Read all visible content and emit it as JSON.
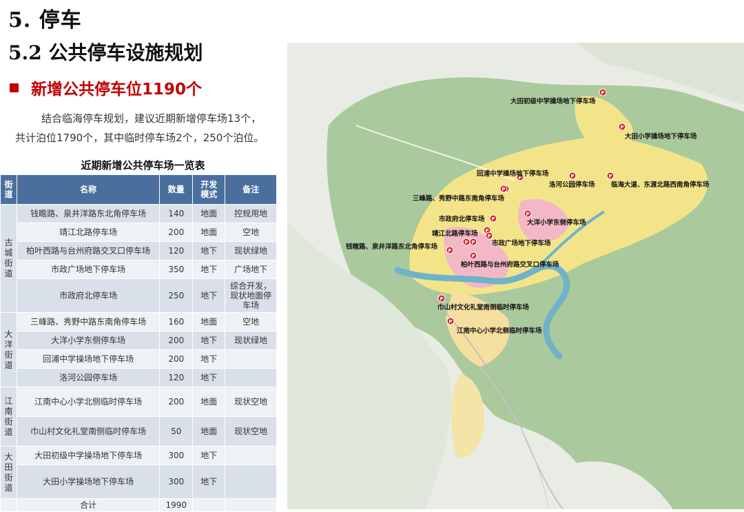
{
  "heading1": "5. 停车",
  "heading2": "5.2 公共停车设施规划",
  "heading3": "新增公共停车位1190个",
  "paragraph_line1": "结合临海停车规划，建议近期新增停车场13个，",
  "paragraph_line2": "共计泊位1790个，其中临时停车场2个，250个泊位。",
  "table_title": "近期新增公共停车场一览表",
  "table_headers": {
    "street": "街道",
    "name": "名称",
    "count": "数量",
    "mode": "开发模式",
    "note": "备注"
  },
  "streets": {
    "gucheng": "古城街道",
    "dayang": "大洋街道",
    "jiangnan": "江南街道",
    "datian": "大田街道"
  },
  "rows": [
    {
      "name": "钱瞻路、泉井洋路东北角停车场",
      "count": "140",
      "mode": "地面",
      "note": "控规用地"
    },
    {
      "name": "靖江北路停车场",
      "count": "200",
      "mode": "地面",
      "note": "空地"
    },
    {
      "name": "柏叶西路与台州府路交叉口停车场",
      "count": "120",
      "mode": "地下",
      "note": "现状绿地"
    },
    {
      "name": "市政广场地下停车场",
      "count": "350",
      "mode": "地下",
      "note": "广场地下"
    },
    {
      "name": "市政府北停车场",
      "count": "250",
      "mode": "地下",
      "note": "综合开发，现状地面停车场"
    },
    {
      "name": "三峰路、秀野中路东南角停车场",
      "count": "160",
      "mode": "地面",
      "note": "空地"
    },
    {
      "name": "大洋小学东侧停车场",
      "count": "200",
      "mode": "地下",
      "note": "现状绿地"
    },
    {
      "name": "回浦中学操场地下停车场",
      "count": "200",
      "mode": "地下",
      "note": ""
    },
    {
      "name": "洛河公园停车场",
      "count": "120",
      "mode": "地下",
      "note": ""
    },
    {
      "name": "江南中心小学北侧临时停车场",
      "count": "200",
      "mode": "地面",
      "note": "现状空地"
    },
    {
      "name": "巾山村文化礼堂南侧临时停车场",
      "count": "50",
      "mode": "地面",
      "note": "现状空地"
    },
    {
      "name": "大田初级中学操场地下停车场",
      "count": "300",
      "mode": "地下",
      "note": ""
    },
    {
      "name": "大田小学操场地下停车场",
      "count": "300",
      "mode": "地下",
      "note": ""
    }
  ],
  "total": {
    "label": "合计",
    "count": "1990"
  },
  "map_icon": "P",
  "map_labels": [
    "大田初级中学操场地下停车场",
    "大田小学操场地下停车场",
    "回浦中学操场地下停车场",
    "洛河公园停车场",
    "临海大道、东渡北路西南角停车场",
    "三峰路、秀野中路东南角停车场",
    "大洋小学东侧停车场",
    "市政府北停车场",
    "靖江北路停车场",
    "市政广场地下停车场",
    "钱暄路、泉井洋路东北角停车场",
    "柏叶西路与台州府路交叉口停车场",
    "巾山村文化礼堂南侧临时停车场",
    "江南中心小学北侧临时停车场"
  ],
  "colors": {
    "accent": "#c00000",
    "header": "#4a6f9f",
    "marker": "#d4202a"
  }
}
